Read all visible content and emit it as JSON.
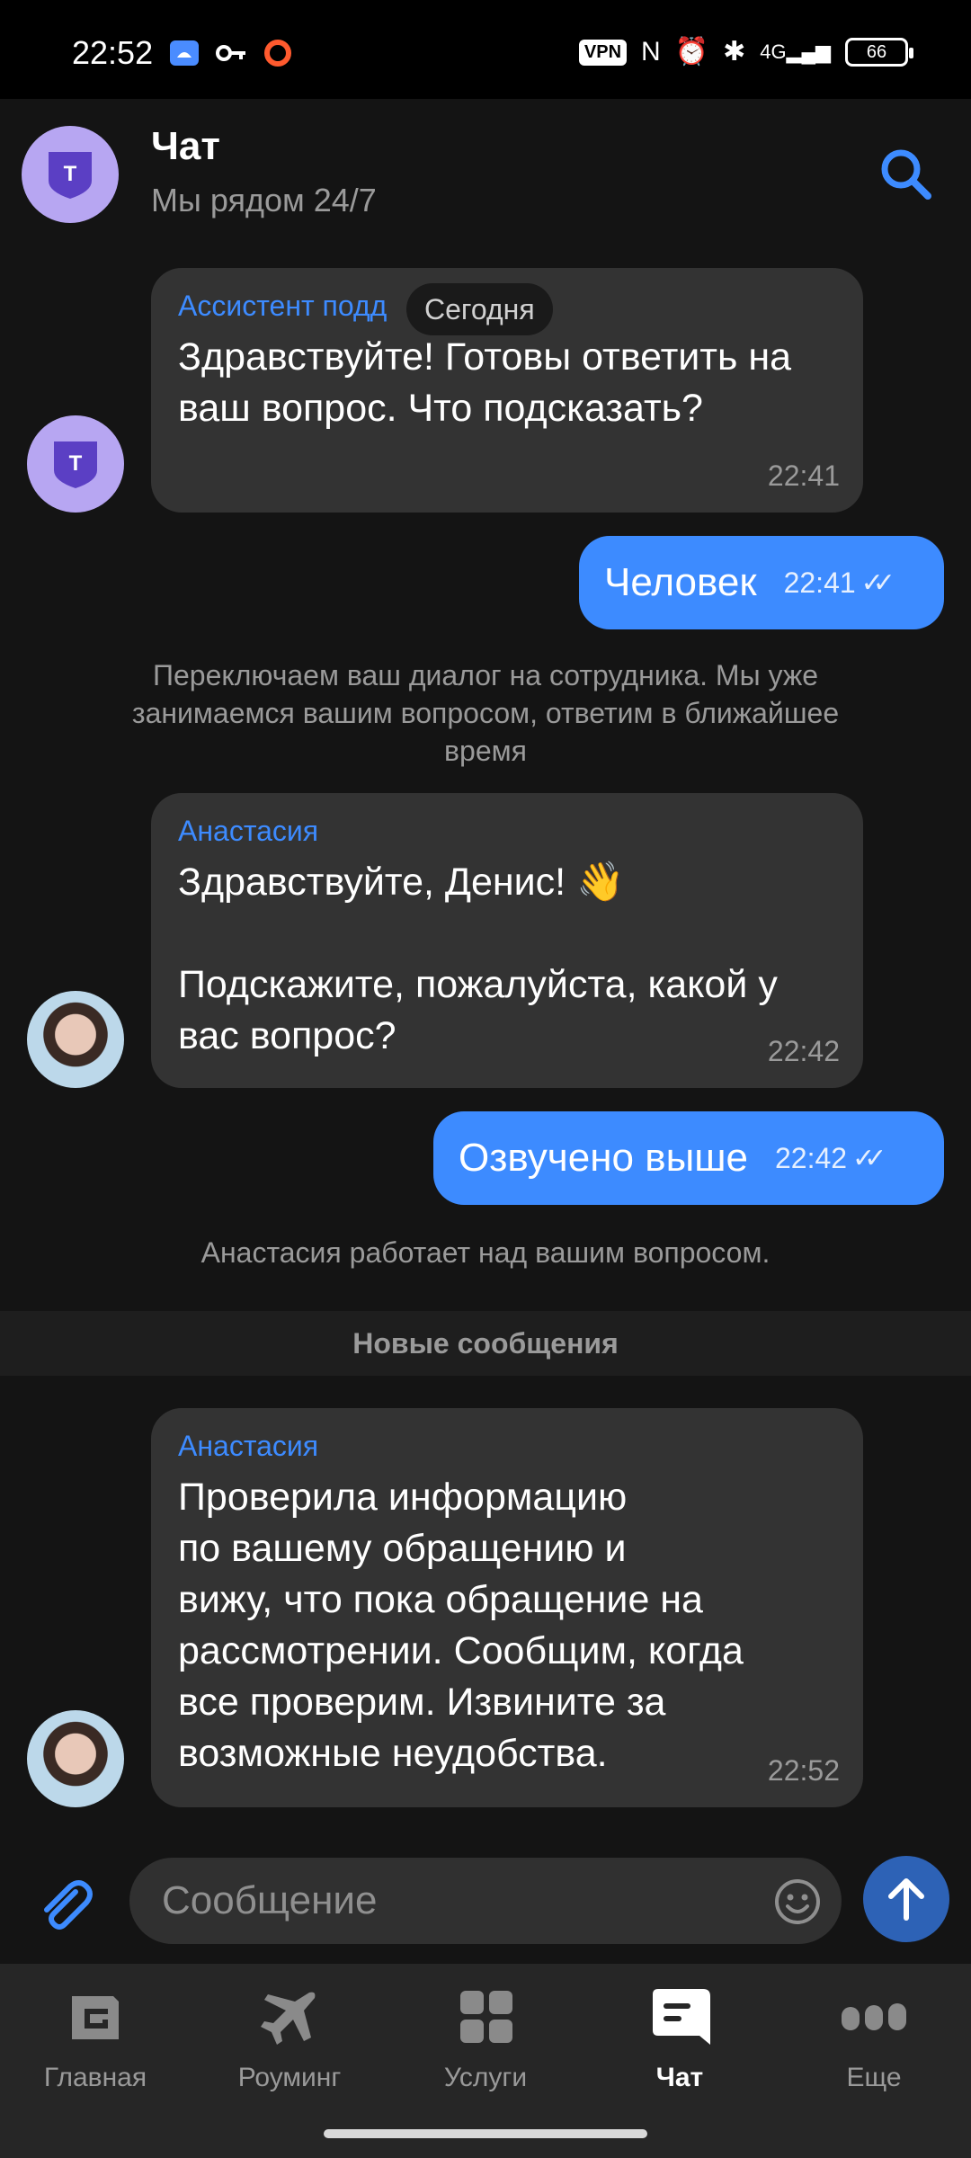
{
  "status_bar": {
    "time": "22:52",
    "left_icons": [
      "android-icon",
      "key-icon",
      "ring-icon"
    ],
    "vpn": "VPN",
    "network": "4G",
    "battery": "66"
  },
  "header": {
    "title": "Чат",
    "subtitle": "Мы рядом 24/7",
    "avatar_letter": "T"
  },
  "date_chip": "Сегодня",
  "messages": [
    {
      "sender": "Ассистент подд",
      "text": "Здравствуйте! Готовы ответить на ваш вопрос. Что подсказать?",
      "time": "22:41"
    },
    {
      "outgoing": true,
      "text": "Человек",
      "time": "22:41",
      "ticks": "✓✓"
    },
    {
      "system": "Переключаем ваш диалог на сотрудника. Мы уже занимаемся вашим вопросом, ответим в ближайшее время"
    },
    {
      "sender": "Анастасия",
      "text": "Здравствуйте, Денис! 👋\n\nПодскажите, пожалуйста, какой у вас вопрос?",
      "time": "22:42"
    },
    {
      "outgoing": true,
      "text": "Озвучено выше",
      "time": "22:42",
      "ticks": "✓✓"
    },
    {
      "system": "Анастасия работает над вашим вопросом."
    },
    {
      "sender": "Анастасия",
      "text": "Проверила информацию\nпо вашему обращению и\nвижу, что пока обращение на\nрассмотрении. Сообщим, когда\nвсе проверим. Извините за\nвозможные неудобства.",
      "time": "22:52"
    }
  ],
  "new_messages_divider": "Новые сообщения",
  "composer": {
    "placeholder": "Сообщение"
  },
  "nav": {
    "items": [
      {
        "label": "Главная",
        "icon": "home-icon"
      },
      {
        "label": "Роуминг",
        "icon": "plane-icon"
      },
      {
        "label": "Услуги",
        "icon": "grid-icon"
      },
      {
        "label": "Чат",
        "icon": "chat-icon",
        "active": true
      },
      {
        "label": "Еще",
        "icon": "more-icon"
      }
    ]
  },
  "colors": {
    "accent": "#3d8bff",
    "bubble_in": "#333333",
    "background": "#141414",
    "bot_avatar": "#b7a6f2"
  }
}
